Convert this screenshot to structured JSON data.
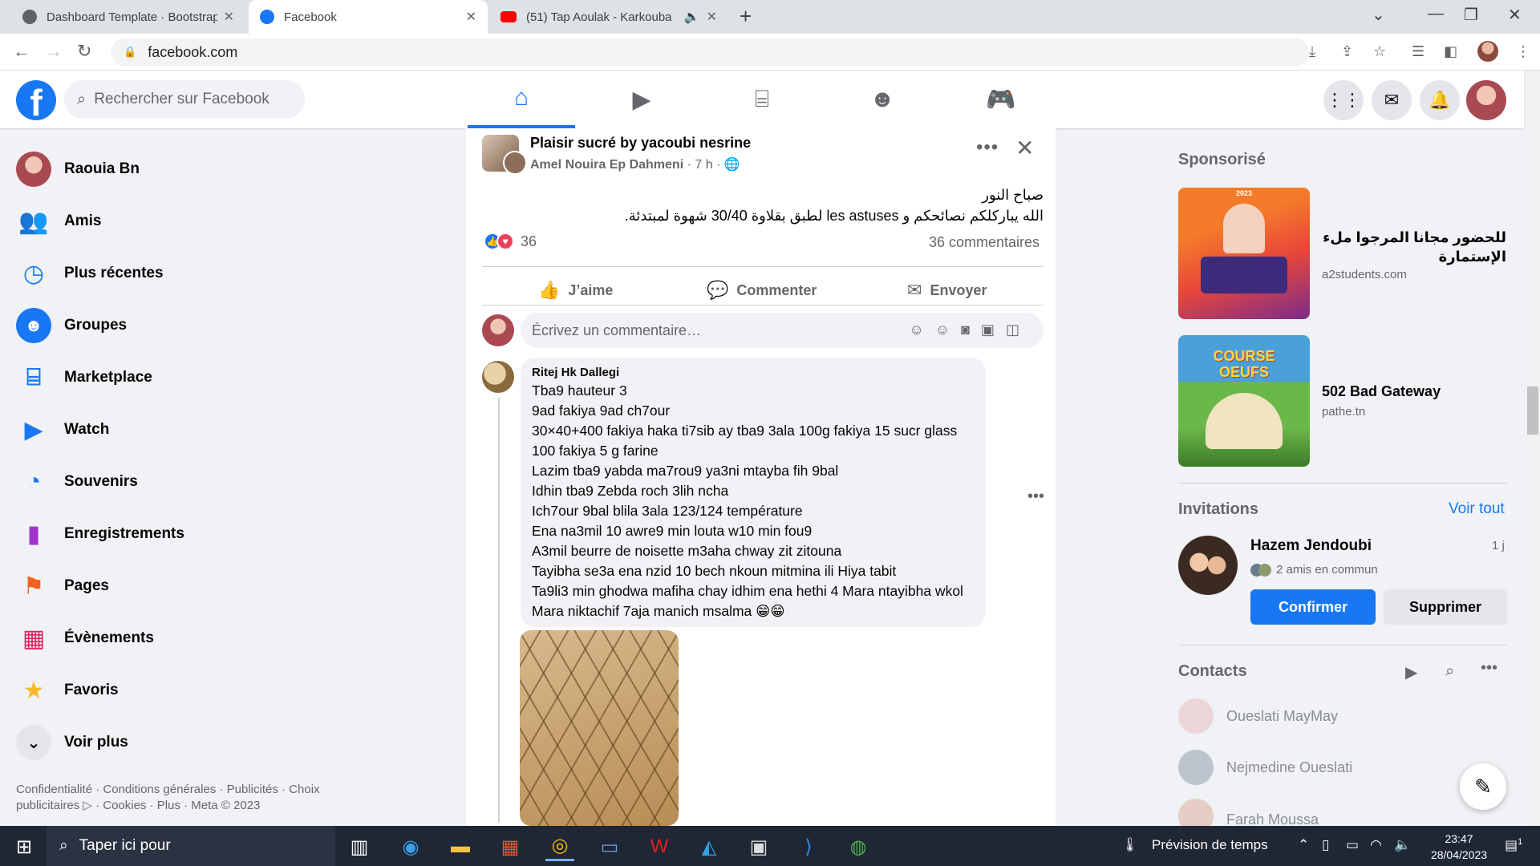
{
  "browser": {
    "tabs": [
      {
        "title": "Dashboard Template · Bootstrap",
        "favicon_color": "#5f6368"
      },
      {
        "title": "Facebook",
        "favicon_color": "#1877f2"
      },
      {
        "title": "(51) Tap Aoulak - Karkouba",
        "favicon_color": "#ff0000"
      }
    ],
    "new_tab": "+",
    "url": "facebook.com"
  },
  "header": {
    "logo": "f",
    "search_placeholder": "Rechercher sur Facebook",
    "nav_icons": [
      "home-icon",
      "watch-icon",
      "marketplace-icon",
      "groups-icon",
      "gaming-icon"
    ]
  },
  "sidebar": {
    "items": [
      {
        "label": "Raouia Bn",
        "icon": "profile-avatar"
      },
      {
        "label": "Amis",
        "icon": "friends-icon"
      },
      {
        "label": "Plus récentes",
        "icon": "recent-icon"
      },
      {
        "label": "Groupes",
        "icon": "groups-icon"
      },
      {
        "label": "Marketplace",
        "icon": "marketplace-icon"
      },
      {
        "label": "Watch",
        "icon": "watch-icon"
      },
      {
        "label": "Souvenirs",
        "icon": "memories-icon"
      },
      {
        "label": "Enregistrements",
        "icon": "saved-icon"
      },
      {
        "label": "Pages",
        "icon": "pages-icon"
      },
      {
        "label": "Évènements",
        "icon": "events-icon"
      },
      {
        "label": "Favoris",
        "icon": "favorites-icon"
      },
      {
        "label": "Voir plus",
        "icon": "chevron-down-icon"
      }
    ],
    "footer_line1": "Confidentialité · Conditions générales · Publicités · Choix",
    "footer_line2": "publicitaires ▷ · Cookies · Plus · Meta © 2023"
  },
  "post": {
    "group": "Plaisir sucré by yacoubi nesrine",
    "author": "Amel Nouira Ep Dahmeni",
    "time": " · 7 h · ",
    "text_line1": "صباح النور",
    "text_line2": "الله يباركلكم نصائحكم و les astuses لطبق بقلاوة 30/40 شهوة  لمبتدئة.",
    "reaction_count": "36",
    "comment_count": "36 commentaires",
    "actions": {
      "like": "J’aime",
      "comment": "Commenter",
      "share": "Envoyer"
    },
    "comment_placeholder": "Écrivez un commentaire…"
  },
  "comment": {
    "author": "Ritej Hk Dallegi",
    "lines": [
      "Tba9 hauteur 3",
      "9ad fakiya 9ad ch7our",
      "30×40+400 fakiya haka ti7sib ay tba9 3ala 100g fakiya 15 sucr glass",
      "100 fakiya 5 g farine",
      "Lazim tba9 yabda ma7rou9 ya3ni mtayba fih 9bal",
      "Idhin tba9 Zebda roch 3lih ncha",
      "Ich7our 9bal blila 3ala 123/124 température",
      "Ena na3mil 10 awre9 min louta w10 min fou9",
      "A3mil beurre de noisette m3aha chway zit zitouna",
      "Tayibha se3a ena nzid 10 bech nkoun mitmina ili Hiya tabit",
      "Ta9li3 min ghodwa mafiha chay idhim ena hethi 4 Mara ntayibha wkol",
      "Mara niktachif 7aja manich msalma 😁😁"
    ]
  },
  "right": {
    "sponsored_title": "Sponsorisé",
    "ads": [
      {
        "title": "للحضور مجانا المرجوا ملء الإستمارة",
        "url": "a2students.com",
        "image_text": "2023"
      },
      {
        "title": "502 Bad Gateway",
        "url": "pathe.tn",
        "image_text": "COURSE OEUFS"
      }
    ],
    "invitations_title": "Invitations",
    "see_all": "Voir tout",
    "invite": {
      "name": "Hazem Jendoubi",
      "time": "1 j",
      "mutual": "2 amis en commun",
      "confirm": "Confirmer",
      "delete": "Supprimer"
    },
    "contacts_title": "Contacts",
    "contacts": [
      "Oueslati MayMay",
      "Nejmedine Oueslati",
      "Farah Moussa"
    ]
  },
  "taskbar": {
    "search_placeholder": "Taper ici pour",
    "weather": "Prévision de temps",
    "time": "23:47",
    "date": "28/04/2023",
    "notification_count": "1"
  },
  "colors": {
    "fb_blue": "#1877f2",
    "taskbar": "#1f2634"
  }
}
